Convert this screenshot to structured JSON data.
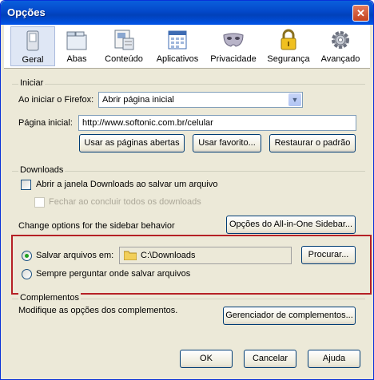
{
  "window": {
    "title": "Opções",
    "close_label": "✕"
  },
  "toolbar": {
    "items": [
      {
        "label": "Geral",
        "icon": "switch-icon"
      },
      {
        "label": "Abas",
        "icon": "tabs-icon"
      },
      {
        "label": "Conteúdo",
        "icon": "content-icon"
      },
      {
        "label": "Aplicativos",
        "icon": "applications-icon"
      },
      {
        "label": "Privacidade",
        "icon": "mask-icon"
      },
      {
        "label": "Segurança",
        "icon": "lock-icon"
      },
      {
        "label": "Avançado",
        "icon": "gear-icon"
      }
    ],
    "selected": "Geral"
  },
  "iniciar": {
    "title": "Iniciar",
    "startup_label": "Ao iniciar o Firefox:",
    "startup_value": "Abrir página inicial",
    "homepage_label": "Página inicial:",
    "homepage_value": "http://www.softonic.com.br/celular",
    "btn_current": "Usar as páginas abertas",
    "btn_bookmark": "Usar favorito...",
    "btn_restore": "Restaurar o padrão"
  },
  "downloads": {
    "title": "Downloads",
    "show_window": "Abrir a janela Downloads ao salvar um arquivo",
    "close_when_done": "Fechar ao concluir todos os downloads",
    "sidebar_label": "Change options for the sidebar behavior",
    "sidebar_button": "Opções do All-in-One Sidebar...",
    "save_to_label": "Salvar arquivos em:",
    "save_path": "C:\\Downloads",
    "browse_button": "Procurar...",
    "always_ask": "Sempre perguntar onde salvar arquivos"
  },
  "complementos": {
    "title": "Complementos",
    "description": "Modifique as opções dos complementos.",
    "manage_button": "Gerenciador de complementos..."
  },
  "footer": {
    "ok": "OK",
    "cancel": "Cancelar",
    "help": "Ajuda"
  },
  "colors": {
    "titlebar": "#0348c9",
    "highlight_border": "#b52025",
    "window_bg": "#ece9d8"
  }
}
